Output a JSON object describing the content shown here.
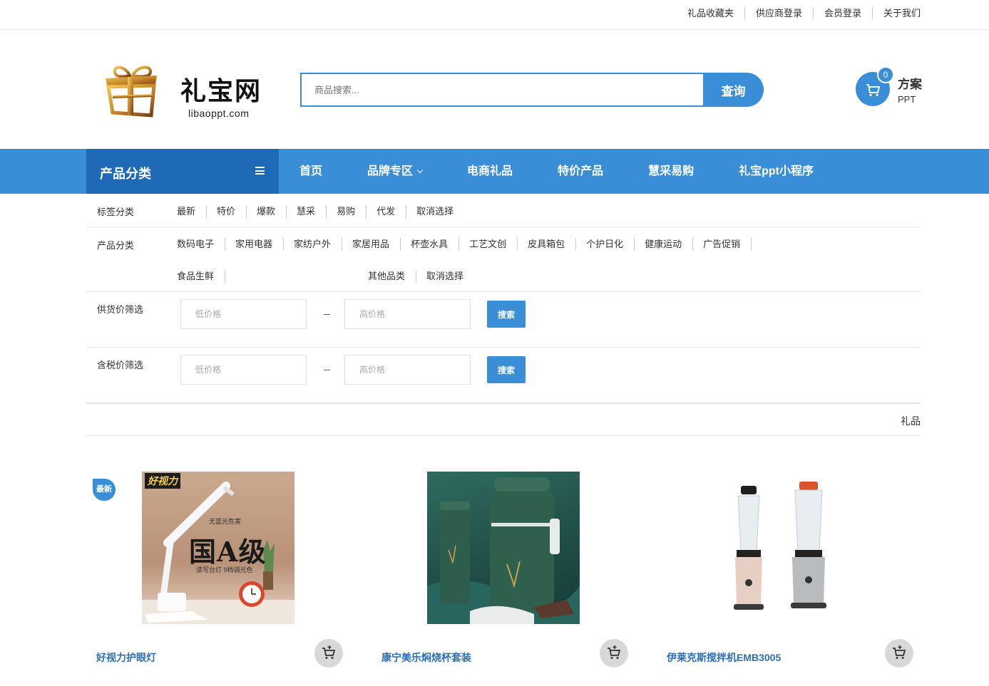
{
  "toplinks": [
    "礼品收藏夹",
    "供应商登录",
    "会员登录",
    "关于我们"
  ],
  "logo": {
    "title": "礼宝网",
    "subtitle": "libaoppt.com"
  },
  "search": {
    "placeholder": "商品搜索...",
    "button": "查询"
  },
  "cart": {
    "count": "0",
    "label_main": "方案",
    "label_sub": "PPT"
  },
  "nav": {
    "category_label": "产品分类",
    "items": [
      "首页",
      "品牌专区",
      "电商礼品",
      "特价产品",
      "慧采易购",
      "礼宝ppt小程序"
    ]
  },
  "filters": {
    "tag": {
      "label": "标签分类",
      "options": [
        "最新",
        "特价",
        "爆款",
        "慧采",
        "易购",
        "代发",
        "取消选择"
      ]
    },
    "category": {
      "label": "产品分类",
      "options": [
        "数码电子",
        "家用电器",
        "家纺户外",
        "家居用品",
        "杯壶水具",
        "工艺文创",
        "皮具箱包",
        "个护日化",
        "健康运动",
        "广告促销",
        "食品生鲜",
        "其他品类",
        "取消选择"
      ]
    },
    "supply_price": {
      "label": "供货价筛选",
      "low_placeholder": "低价格",
      "high_placeholder": "高价格",
      "button": "搜索"
    },
    "tax_price": {
      "label": "含税价筛选",
      "low_placeholder": "低价格",
      "high_placeholder": "高价格",
      "button": "搜索"
    }
  },
  "sort": {
    "label": "礼品"
  },
  "products": [
    {
      "title": "好视力护眼灯",
      "badge": "最新",
      "image_text": {
        "brand": "好视力",
        "tag": "无蓝光危害",
        "headline": "国A级",
        "caption": "读写台灯 9档调光色"
      }
    },
    {
      "title": "康宁美乐焖烧杯套装"
    },
    {
      "title": "伊莱克斯搅拌机EMB3005"
    }
  ],
  "colors": {
    "accent": "#3a8ed8",
    "nav_dark": "#1e6ab7",
    "product_title": "#2b6fb5"
  }
}
